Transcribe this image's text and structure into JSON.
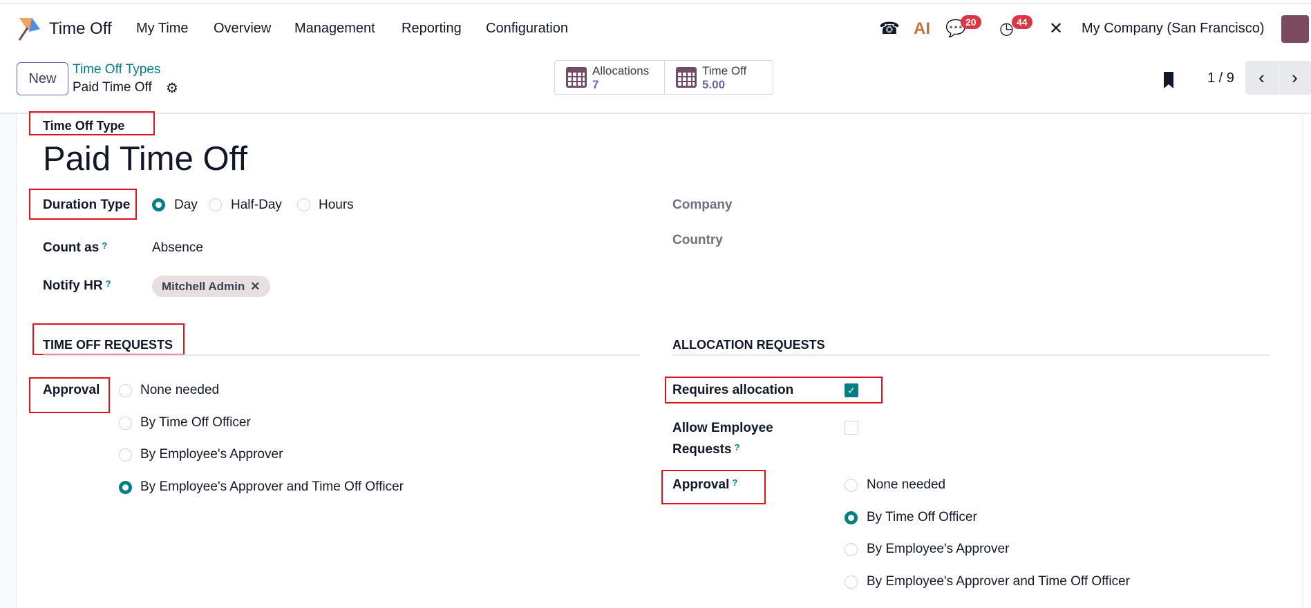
{
  "navbar": {
    "app_name": "Time Off",
    "menu": [
      "My Time",
      "Overview",
      "Management",
      "Reporting",
      "Configuration"
    ],
    "chat_badge": "20",
    "activity_badge": "44",
    "company": "My Company (San Francisco)"
  },
  "control": {
    "new_label": "New",
    "breadcrumb_parent": "Time Off Types",
    "breadcrumb_current": "Paid Time Off",
    "stats": [
      {
        "label": "Allocations",
        "value": "7"
      },
      {
        "label": "Time Off",
        "value": "5.00"
      }
    ],
    "pager": "1 / 9"
  },
  "form": {
    "type_label": "Time Off Type",
    "title": "Paid Time Off",
    "duration_label": "Duration Type",
    "duration_options": [
      "Day",
      "Half-Day",
      "Hours"
    ],
    "duration_selected": "Day",
    "count_as_label": "Count as",
    "count_as_help": "?",
    "count_as_value": "Absence",
    "notify_label": "Notify HR",
    "notify_help": "?",
    "notify_tag": "Mitchell Admin",
    "company_label": "Company",
    "country_label": "Country",
    "timeoff_section": "TIME OFF REQUESTS",
    "timeoff_approval_label": "Approval",
    "timeoff_approval_options": [
      "None needed",
      "By Time Off Officer",
      "By Employee's Approver",
      "By Employee's Approver and Time Off Officer"
    ],
    "timeoff_approval_selected": 3,
    "alloc_section": "ALLOCATION REQUESTS",
    "requires_allocation_label": "Requires allocation",
    "requires_allocation": true,
    "allow_requests_label_1": "Allow Employee",
    "allow_requests_label_2": "Requests",
    "allow_requests_help": "?",
    "allow_requests": false,
    "alloc_approval_label": "Approval",
    "alloc_approval_help": "?",
    "alloc_approval_options": [
      "None needed",
      "By Time Off Officer",
      "By Employee's Approver",
      "By Employee's Approver and Time Off Officer"
    ],
    "alloc_approval_selected": 1
  },
  "colors": {
    "accent": "#017e84",
    "brand": "#714b67",
    "highlight": "#e3101e"
  }
}
